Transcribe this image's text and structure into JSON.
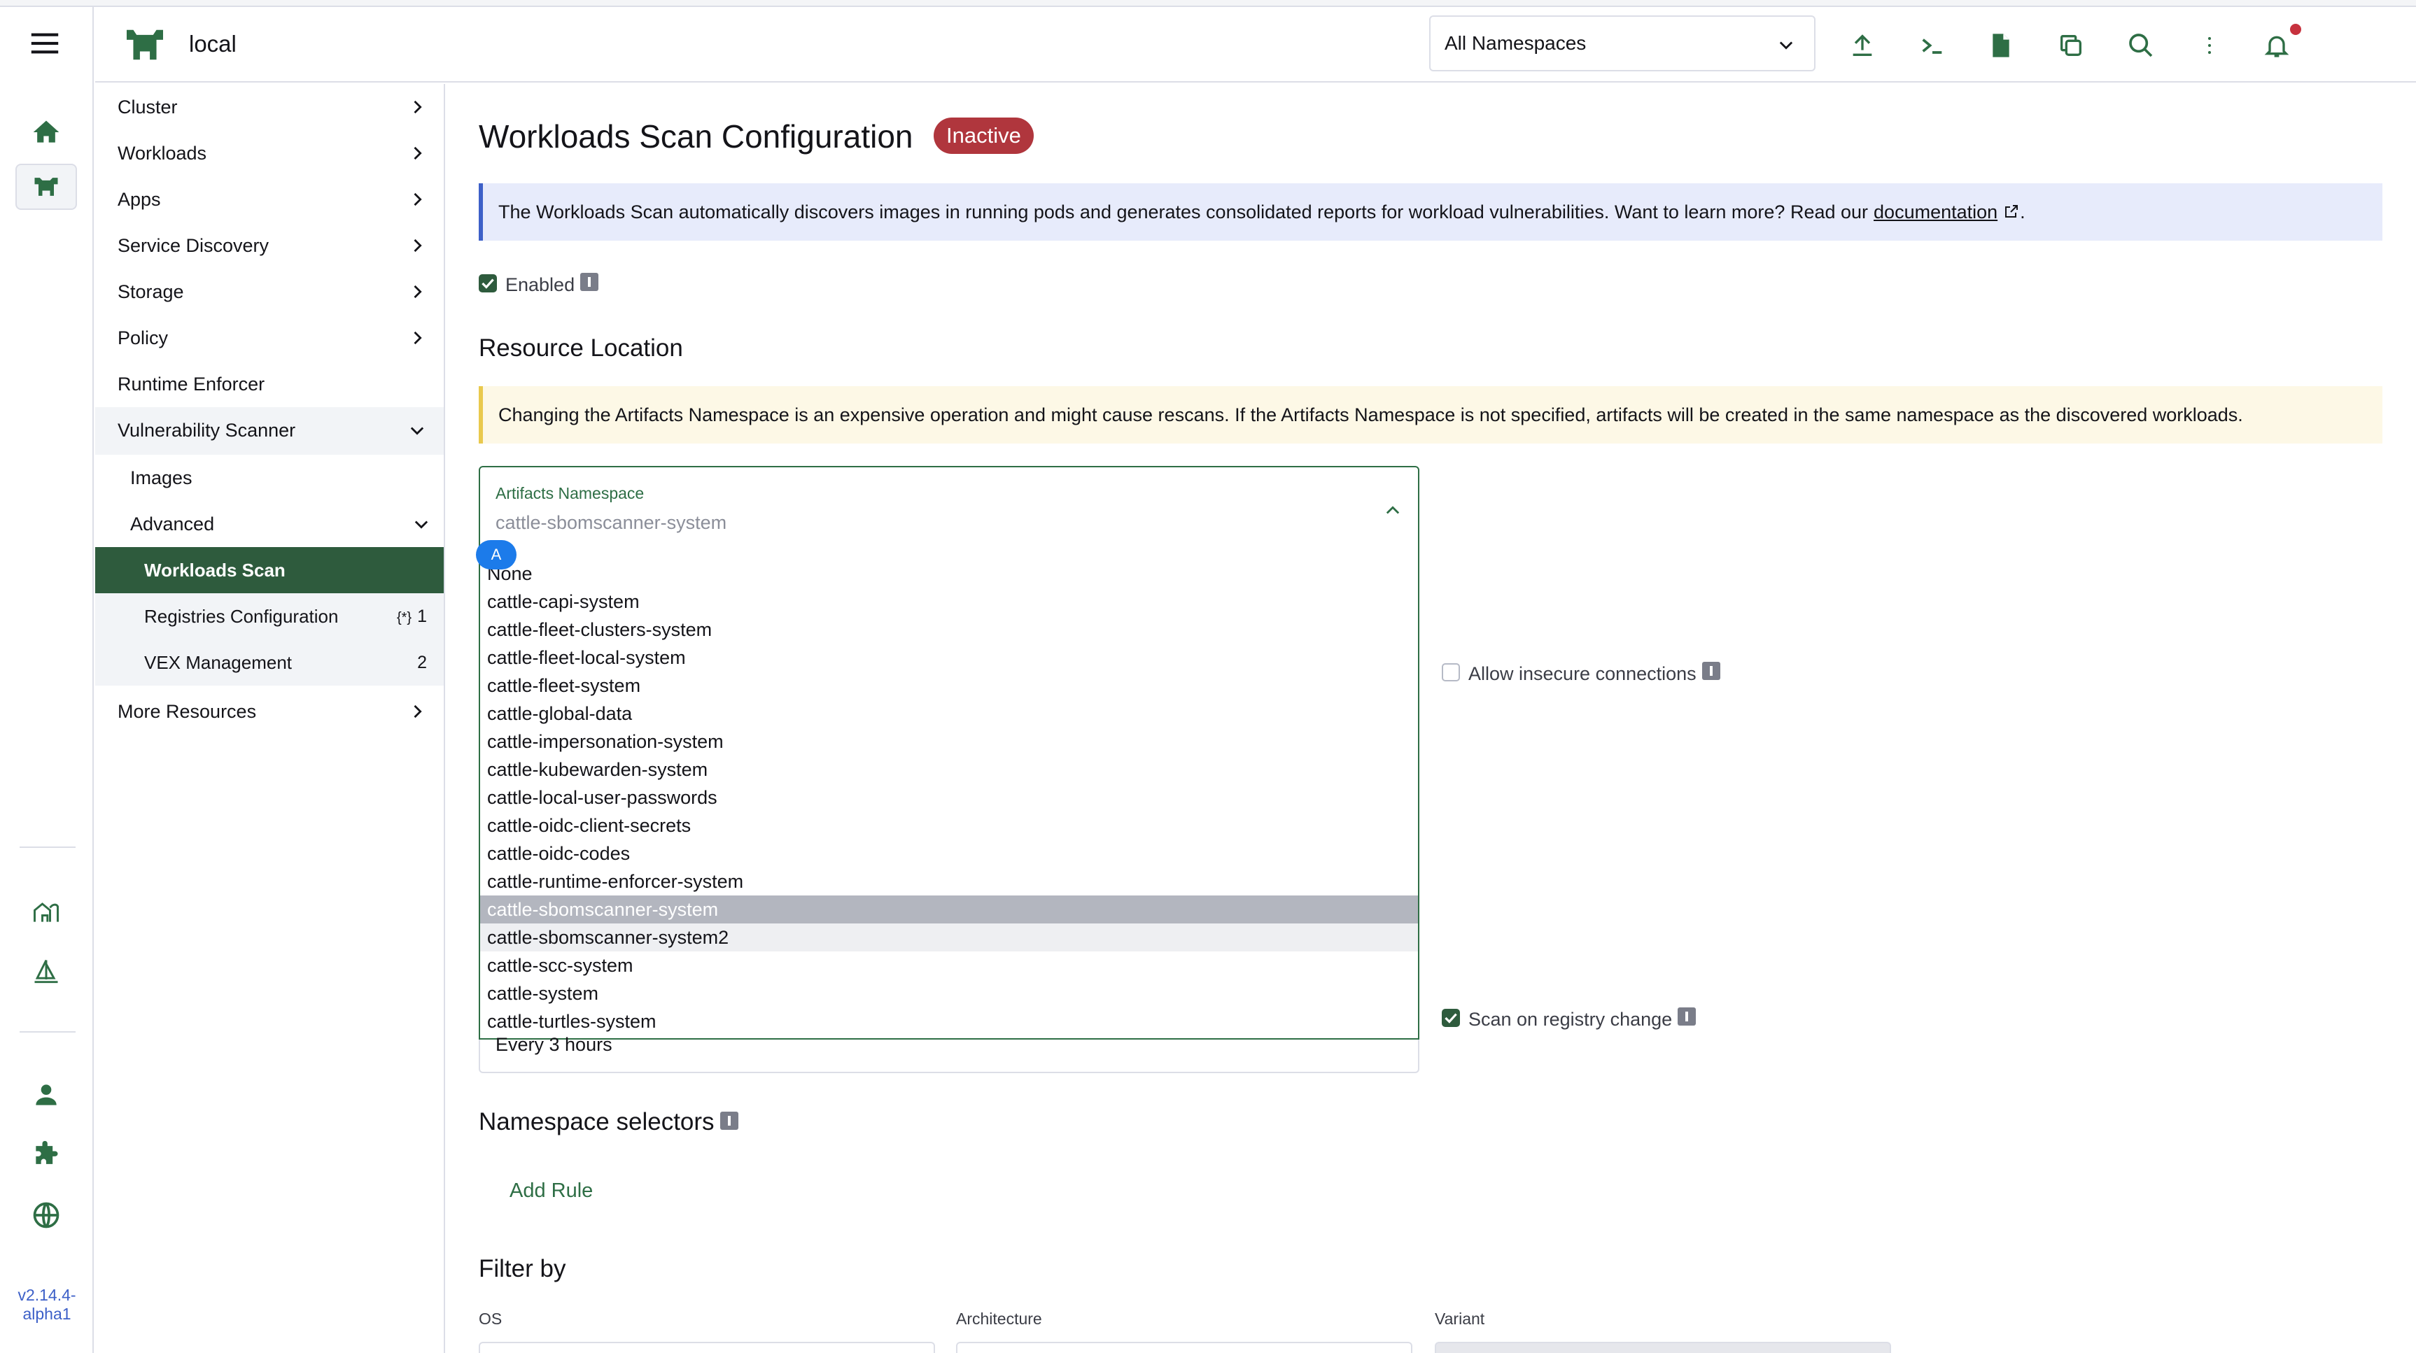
{
  "header": {
    "cluster_name": "local",
    "namespace_select": "All Namespaces",
    "icons": [
      "upload-icon",
      "terminal-icon",
      "file-icon",
      "copy-icon",
      "search-icon",
      "more-icon",
      "bell-icon"
    ]
  },
  "rail": {
    "version": "v2.14.4-\nalpha1",
    "icons": [
      "home-icon",
      "cluster-icon",
      "fleet-icon",
      "sail-icon",
      "user-icon",
      "puzzle-icon",
      "globe-icon"
    ]
  },
  "sidenav": {
    "cluster": "Cluster",
    "workloads": "Workloads",
    "apps": "Apps",
    "service_discovery": "Service Discovery",
    "storage": "Storage",
    "policy": "Policy",
    "runtime_enforcer": "Runtime Enforcer",
    "vulnerability_scanner": "Vulnerability Scanner",
    "images": "Images",
    "advanced": "Advanced",
    "workloads_scan": "Workloads Scan",
    "registries_configuration": "Registries Configuration",
    "registries_count": "1",
    "registries_brace": "{*}",
    "vex_management": "VEX Management",
    "vex_count": "2",
    "more_resources": "More Resources"
  },
  "main": {
    "title": "Workloads Scan Configuration",
    "status_badge": "Inactive",
    "info_text": "The Workloads Scan automatically discovers images in running pods and generates consolidated reports for workload vulnerabilities. Want to learn more? Read our",
    "info_link": "documentation",
    "info_end": ".",
    "enabled_label": "Enabled",
    "resource_location_title": "Resource Location",
    "warning_text": "Changing the Artifacts Namespace is an expensive operation and might cause rescans. If the Artifacts Namespace is not specified, artifacts will be created in the same namespace as the discovered workloads.",
    "artifacts_label": "Artifacts Namespace",
    "artifacts_value": "cattle-sbomscanner-system",
    "marker": "A",
    "options": [
      "None",
      "cattle-capi-system",
      "cattle-fleet-clusters-system",
      "cattle-fleet-local-system",
      "cattle-fleet-system",
      "cattle-global-data",
      "cattle-impersonation-system",
      "cattle-kubewarden-system",
      "cattle-local-user-passwords",
      "cattle-oidc-client-secrets",
      "cattle-oidc-codes",
      "cattle-runtime-enforcer-system",
      "cattle-sbomscanner-system",
      "cattle-sbomscanner-system2",
      "cattle-scc-system",
      "cattle-system",
      "cattle-turtles-system"
    ],
    "selected_option": "cattle-sbomscanner-system",
    "allow_insecure_label": "Allow insecure connections",
    "scan_interval_value": "Every 3 hours",
    "scan_on_change_label": "Scan on registry change",
    "namespace_selectors_title": "Namespace selectors",
    "add_rule": "Add Rule",
    "filter_by_title": "Filter by",
    "os_label": "OS",
    "architecture_label": "Architecture",
    "variant_label": "Variant"
  },
  "colors": {
    "accent": "#2e6e45",
    "selected_nav": "#2e5b3d",
    "badge": "#b0363d",
    "info_border": "#3d60c8",
    "warn_border": "#e9c94d"
  }
}
